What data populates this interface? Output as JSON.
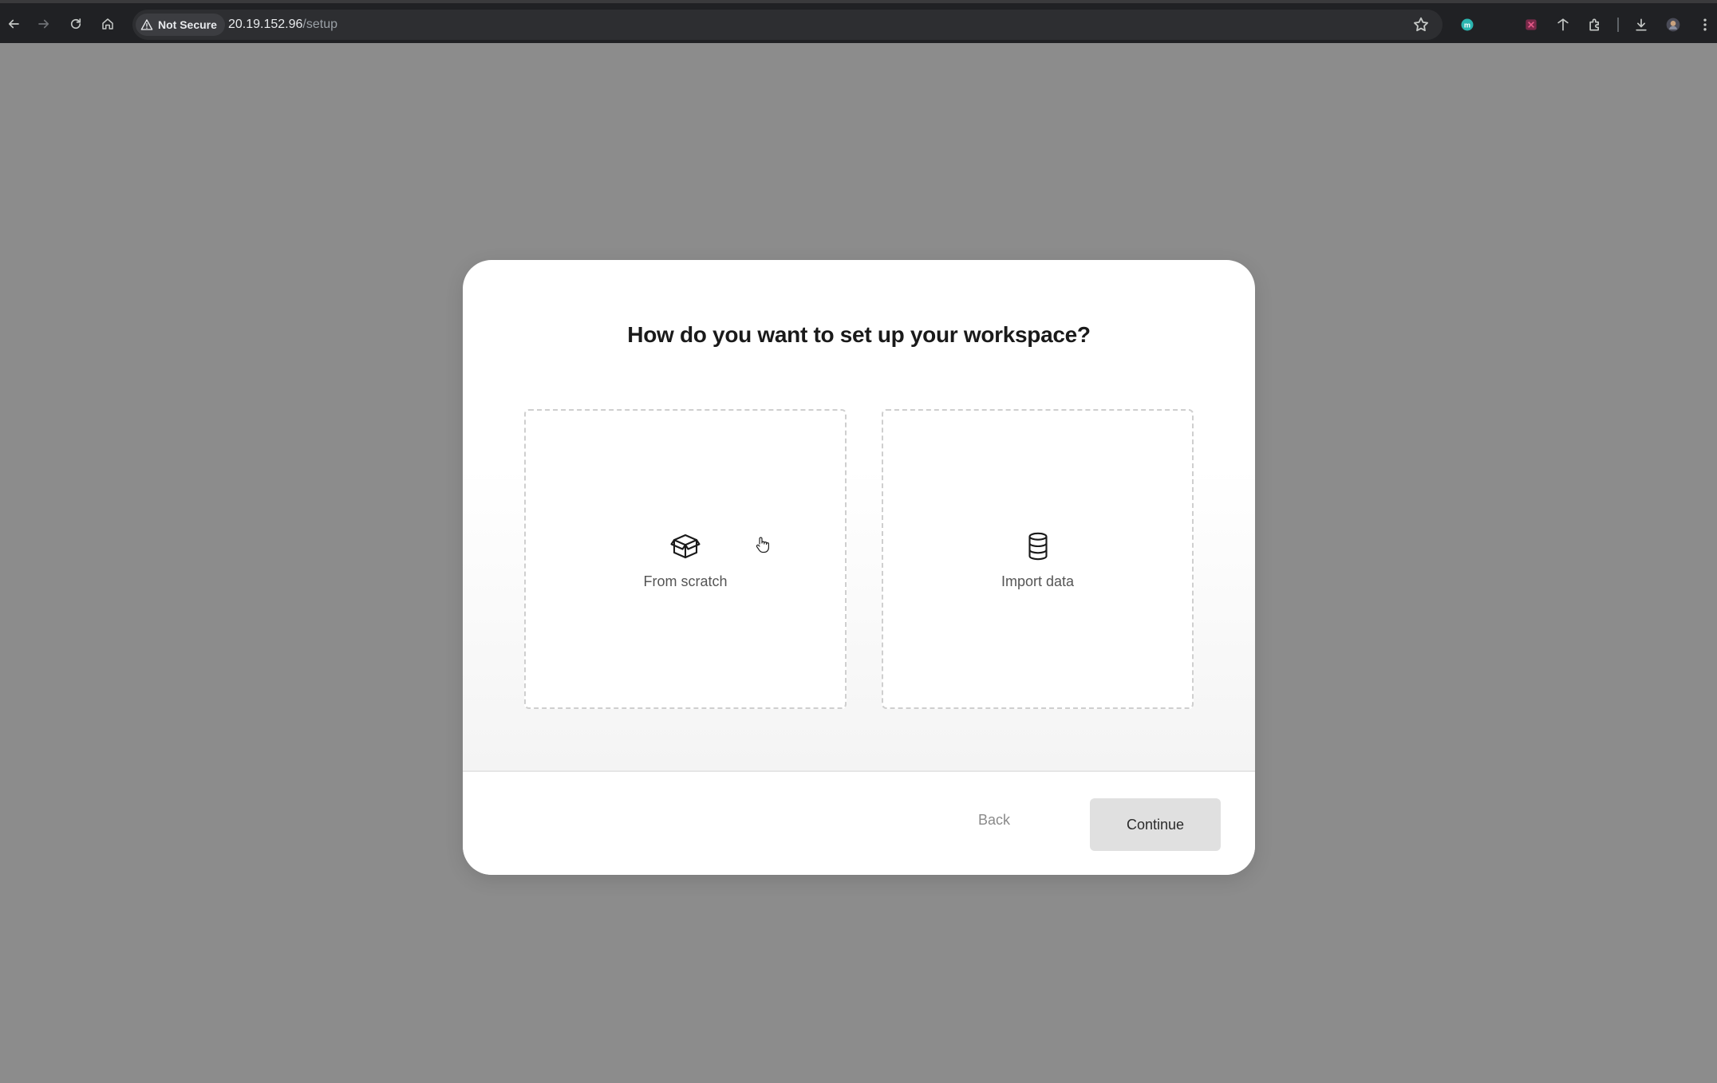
{
  "browser": {
    "security_label": "Not Secure",
    "url_host": "20.19.152.96",
    "url_path": "/setup",
    "icons": [
      "back-arrow-icon",
      "forward-arrow-icon",
      "reload-icon",
      "home-icon",
      "warning-icon",
      "star-icon",
      "extension-m-icon",
      "extension-app-icon",
      "extension-pin-icon",
      "puzzle-icon",
      "download-icon",
      "profile-avatar-icon",
      "kebab-menu-icon"
    ]
  },
  "modal": {
    "title": "How do you want to set up your workspace?",
    "options": [
      {
        "label": "From scratch",
        "icon": "box-icon"
      },
      {
        "label": "Import data",
        "icon": "database-icon"
      }
    ],
    "back_label": "Back",
    "continue_label": "Continue"
  },
  "colors": {
    "backdrop": "#8c8c8c",
    "browser_chrome": "#202124",
    "continue_button": "#e0e0e0"
  }
}
